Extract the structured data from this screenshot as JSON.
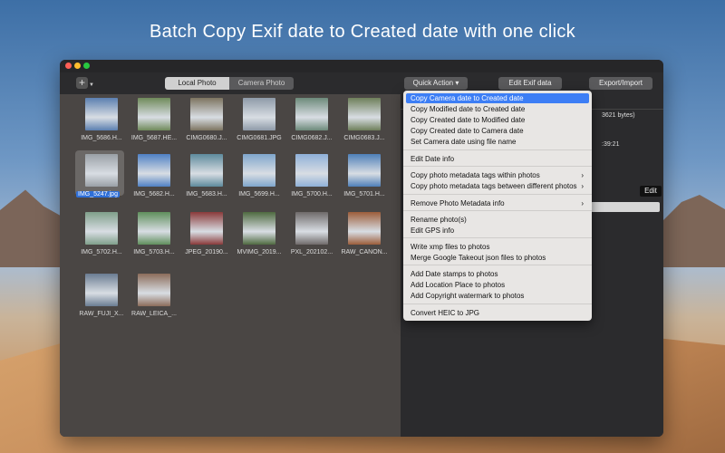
{
  "headline": "Batch Copy Exif date to Created date with one click",
  "toolbar": {
    "add_icon": "+",
    "tabs": [
      "Local Photo",
      "Camera Photo"
    ],
    "quick_action": "Quick Action ▾",
    "edit_exif": "Edit Exif data",
    "export_import": "Export/Import"
  },
  "thumbnails": [
    {
      "label": "IMG_5686.H...",
      "color": "#5b7fb0"
    },
    {
      "label": "IMG_5687.HE...",
      "color": "#6f8a5a"
    },
    {
      "label": "CIMG0680.J...",
      "color": "#7d7460"
    },
    {
      "label": "CIMG0681.JPG",
      "color": "#8e9aa8"
    },
    {
      "label": "CIMG0682.J...",
      "color": "#6c8a7a"
    },
    {
      "label": "CIMG0683.J...",
      "color": "#6e7f5a"
    },
    {
      "label": "IMG_5247.jpg",
      "color": "#9aa0a6"
    },
    {
      "label": "IMG_5682.H...",
      "color": "#4f80c4"
    },
    {
      "label": "IMG_5683.H...",
      "color": "#5d8a9c"
    },
    {
      "label": "IMG_5699.H...",
      "color": "#7fa6cc"
    },
    {
      "label": "IMG_5700.H...",
      "color": "#8fb0d8"
    },
    {
      "label": "IMG_5701.H...",
      "color": "#4e7fb8"
    },
    {
      "label": "IMG_5702.H...",
      "color": "#7f9f8a"
    },
    {
      "label": "IMG_5703.H...",
      "color": "#5f8f5c"
    },
    {
      "label": "JPEG_20190...",
      "color": "#8a3a3a"
    },
    {
      "label": "MVIMG_2019...",
      "color": "#4f6a40"
    },
    {
      "label": "PXL_202102...",
      "color": "#6f6a6a"
    },
    {
      "label": "RAW_CANON...",
      "color": "#9c5d3a"
    },
    {
      "label": "RAW_FUJI_X...",
      "color": "#6a7c92"
    },
    {
      "label": "RAW_LEICA_...",
      "color": "#8c6c5a"
    }
  ],
  "right_panel": {
    "bytes": "3621 bytes)",
    "time": ":39:21",
    "edit": "Edit"
  },
  "menu": {
    "items": [
      {
        "label": "Copy Camera date to Created date",
        "highlighted": true,
        "submenu": false
      },
      {
        "label": "Copy Modified date to Created date",
        "highlighted": false,
        "submenu": false
      },
      {
        "label": "Copy Created date to Modified date",
        "highlighted": false,
        "submenu": false
      },
      {
        "label": "Copy Created date to Camera date",
        "highlighted": false,
        "submenu": false
      },
      {
        "label": "Set Camera date using file name",
        "highlighted": false,
        "submenu": false
      },
      {
        "label": "Edit Date info",
        "highlighted": false,
        "submenu": false
      },
      {
        "label": "Copy photo metadata tags within photos",
        "highlighted": false,
        "submenu": true
      },
      {
        "label": "Copy photo metadata tags between different photos",
        "highlighted": false,
        "submenu": true
      },
      {
        "label": "Remove Photo Metadata info",
        "highlighted": false,
        "submenu": true
      },
      {
        "label": "Rename photo(s)",
        "highlighted": false,
        "submenu": false
      },
      {
        "label": "Edit GPS  info",
        "highlighted": false,
        "submenu": false
      },
      {
        "label": "Write xmp files to photos",
        "highlighted": false,
        "submenu": false
      },
      {
        "label": "Merge Google Takeout json files to photos",
        "highlighted": false,
        "submenu": false
      },
      {
        "label": "Add Date stamps to photos",
        "highlighted": false,
        "submenu": false
      },
      {
        "label": "Add Location Place to photos",
        "highlighted": false,
        "submenu": false
      },
      {
        "label": "Add Copyright watermark to photos",
        "highlighted": false,
        "submenu": false
      },
      {
        "label": "Convert HEIC to JPG",
        "highlighted": false,
        "submenu": false
      }
    ],
    "arrow": "›"
  }
}
